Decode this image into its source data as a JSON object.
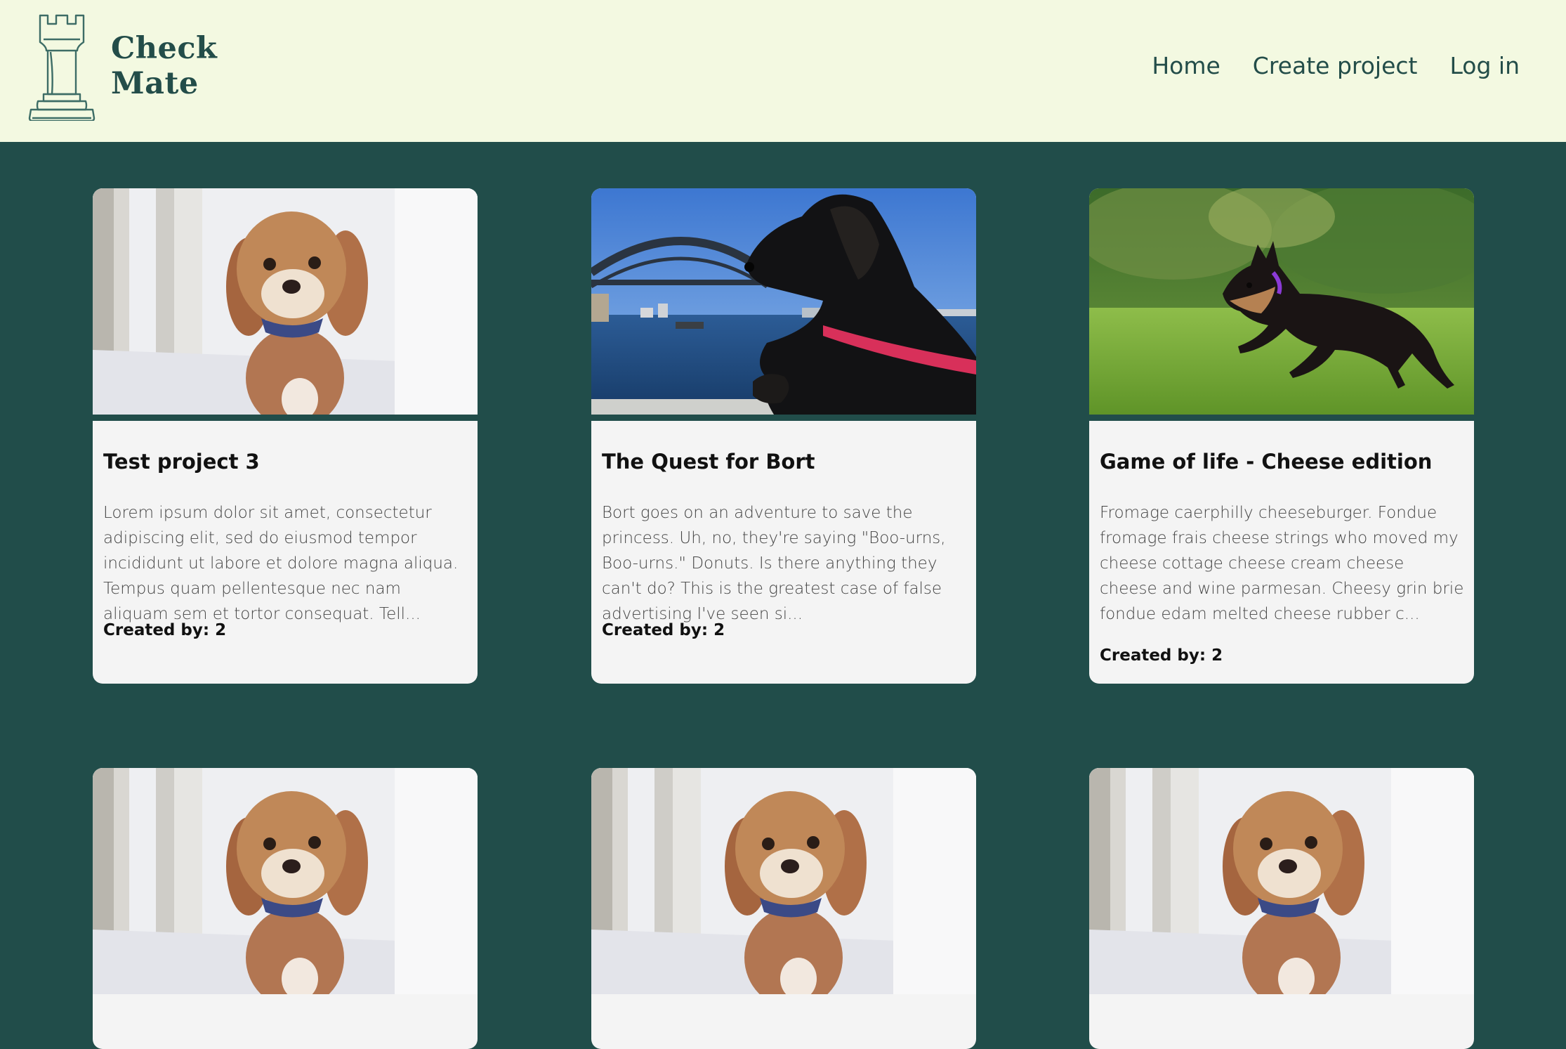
{
  "brand": {
    "line1": "Check",
    "line2": "Mate",
    "logo_icon": "chess-rook-icon"
  },
  "nav": {
    "home": "Home",
    "create": "Create project",
    "login": "Log in"
  },
  "projects": [
    {
      "title": "Test project 3",
      "description": "Lorem ipsum dolor sit amet, consectetur adipiscing elit, sed do eiusmod tempor incididunt ut labore et dolore magna aliqua. Tempus quam pellentesque nec nam aliquam sem et tortor consequat. Tell...",
      "created_by": "Created by: 2",
      "image": "fluffy-dog-photo"
    },
    {
      "title": "The Quest for Bort",
      "description": "Bort goes on an adventure to save the princess. Uh, no, they're saying \"Boo-urns, Boo-urns.\" Donuts. Is there anything they can't do? This is the greatest case of false advertising I've seen si...",
      "created_by": "Created by: 2",
      "image": "dog-harbour-bridge-photo"
    },
    {
      "title": "Game of life - Cheese edition",
      "description": "Fromage caerphilly cheeseburger. Fondue fromage frais cheese strings who moved my cheese cottage cheese cream cheese cheese and wine parmesan. Cheesy grin brie fondue edam melted cheese rubber c...",
      "created_by": "Created by: 2",
      "image": "running-dog-photo"
    },
    {
      "image": "fluffy-dog-photo"
    },
    {
      "image": "fluffy-dog-photo"
    },
    {
      "image": "fluffy-dog-photo"
    }
  ]
}
